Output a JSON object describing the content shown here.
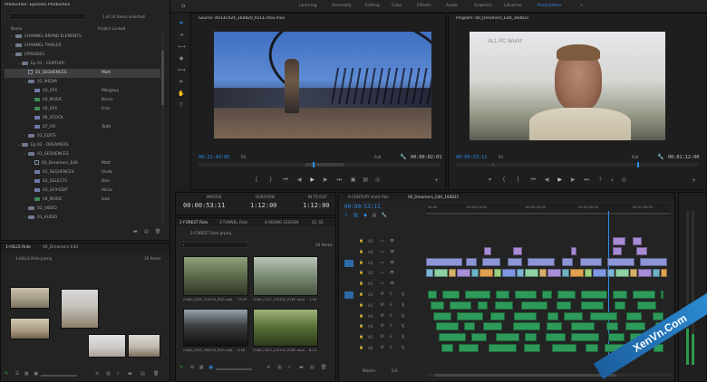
{
  "workspaces": [
    "Learning",
    "Assembly",
    "Editing",
    "Color",
    "Effects",
    "Audio",
    "Graphics",
    "Libraries",
    "Productions"
  ],
  "active_workspace": "Productions",
  "project": {
    "title": "Production: Episodic Production",
    "count": "1 of 24 items selected",
    "search_placeholder": "",
    "col_name": "Name",
    "col_locked": "Project Locked",
    "items": [
      {
        "indent": 1,
        "icon": "folder",
        "label": "CHANNEL BRAND ELEMENTS",
        "lock": "",
        "tri": "›"
      },
      {
        "indent": 1,
        "icon": "folder",
        "label": "CHANNEL TRAILER",
        "lock": "",
        "tri": "›"
      },
      {
        "indent": 1,
        "icon": "folder",
        "label": "EPISODES",
        "lock": "",
        "tri": "⌄"
      },
      {
        "indent": 2,
        "icon": "folder",
        "label": "Ep 01 - CENTURY",
        "lock": "",
        "tri": "⌄"
      },
      {
        "indent": 3,
        "icon": "seq",
        "label": "01_SEQUENCES",
        "lock": "Matt",
        "tri": "",
        "sel": true
      },
      {
        "indent": 3,
        "icon": "folder",
        "label": "02_MEDIA",
        "lock": "",
        "tri": "⌄"
      },
      {
        "indent": 4,
        "icon": "vid",
        "label": "03_SFX",
        "lock": "Margaux",
        "tri": ""
      },
      {
        "indent": 4,
        "icon": "aud",
        "label": "04_MUSIC",
        "lock": "Bruce",
        "tri": ""
      },
      {
        "indent": 4,
        "icon": "aud",
        "label": "05_SFX",
        "lock": "Fran",
        "tri": ""
      },
      {
        "indent": 4,
        "icon": "vid",
        "label": "06_STOCK",
        "lock": "",
        "tri": ""
      },
      {
        "indent": 4,
        "icon": "vid",
        "label": "07_VO",
        "lock": "Todd",
        "tri": ""
      },
      {
        "indent": 3,
        "icon": "folder",
        "label": "03_EDITS",
        "lock": "",
        "tri": "›"
      },
      {
        "indent": 2,
        "icon": "folder",
        "label": "Ep 02 - DREAMERS",
        "lock": "",
        "tri": "⌄"
      },
      {
        "indent": 3,
        "icon": "folder",
        "label": "01_SEQUENCES",
        "lock": "",
        "tri": "⌄"
      },
      {
        "indent": 4,
        "icon": "seq",
        "label": "00_Dreamers_Edit",
        "lock": "Matt",
        "tri": ""
      },
      {
        "indent": 4,
        "icon": "vid",
        "label": "01_SEQUENCES",
        "lock": "Vivek",
        "tri": ""
      },
      {
        "indent": 4,
        "icon": "vid",
        "label": "02_SELECTS",
        "lock": "Dan",
        "tri": ""
      },
      {
        "indent": 4,
        "icon": "vid",
        "label": "03_GFX-EDIT",
        "lock": "Alicia",
        "tri": ""
      },
      {
        "indent": 4,
        "icon": "aud",
        "label": "04_MUSIC",
        "lock": "Ivan",
        "tri": ""
      },
      {
        "indent": 3,
        "icon": "folder",
        "label": "02_VIDEO",
        "lock": "",
        "tri": "›"
      },
      {
        "indent": 3,
        "icon": "folder",
        "label": "03_AUDIO",
        "lock": "",
        "tri": "›"
      }
    ]
  },
  "bin1": {
    "tabs": [
      "1-HILLS Ride",
      "00_Dreamers Edit"
    ],
    "path": "1-HILLS Ride.prproj",
    "count": "16 Items"
  },
  "source": {
    "tab": "Source: A013C024_160820_R1CE.mov.mov",
    "tc_left": "00:22:43:05",
    "fit": "Fit",
    "quality": "Full",
    "tc_right": "00:00:02:01"
  },
  "program": {
    "tab": "Program: 00_Dreamers_Edit_160831",
    "tc_left": "00:00:53:11",
    "fit": "Fit",
    "quality": "Full",
    "tc_right": "00:01:12:00",
    "watermark": "ALL PC World"
  },
  "clip_info": {
    "labels": [
      "MASTER",
      "DURATION",
      "IN TO OUT"
    ],
    "values": [
      "00:00:53:11",
      "1:12:00",
      "1:12:00"
    ]
  },
  "bin2": {
    "tabs": [
      "2-FOREST Ride",
      "3-TUNNEL Ride",
      "4-RIDING LESSON",
      "02_SE"
    ],
    "path": "2-FOREST Ride.prproj",
    "count": "16 Items",
    "clips": [
      {
        "name": "CLN6_C005_210120_R2C.mp4",
        "dur": "13:29"
      },
      {
        "name": "CLN6_C017_210120_R1BC.mp4",
        "dur": "1:06"
      },
      {
        "name": "CLN6_C025_160220_R2C.mp4",
        "dur": "4:18"
      },
      {
        "name": "CLN6_C003_210120_R1BC.mp4",
        "dur": "6:14"
      }
    ]
  },
  "timeline": {
    "tabs": [
      "0-CENTURY short film",
      "00_Dreamers_Edit_160831"
    ],
    "tc": "00:00:53:11",
    "ruler": [
      "00:00",
      "00:00:15:00",
      "00:00:30:00",
      "00:00:45:00",
      "00:01:00:00"
    ],
    "video_tracks": [
      "V5",
      "V4",
      "V3",
      "V2",
      "V1"
    ],
    "audio_tracks": [
      "A1",
      "A2",
      "A3",
      "A4",
      "A5",
      "A6"
    ],
    "mix_label": "Master",
    "mix_value": "0.0"
  },
  "branding": {
    "watermark": "XenVn.Com"
  },
  "colors": {
    "accent": "#2d8ceb",
    "video_clip": "#8c95d6",
    "audio_clip": "#2e9a5a",
    "selected_folder": "#3e3e3e",
    "sequence_clip": "#a98bd6"
  }
}
